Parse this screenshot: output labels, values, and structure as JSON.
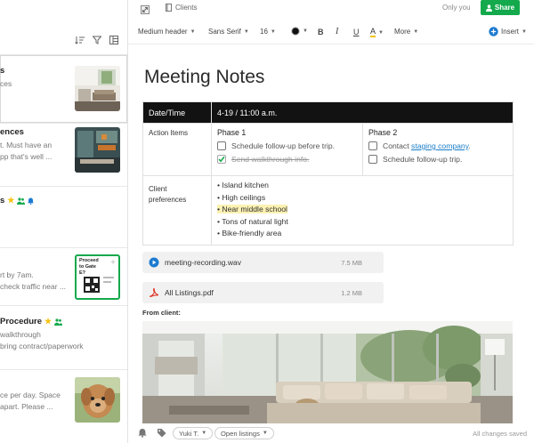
{
  "topbar": {
    "breadcrumb": "Clients",
    "sharing": "Only you",
    "share_label": "Share"
  },
  "toolbar": {
    "style": "Medium header",
    "font": "Sans Serif",
    "size": "16",
    "bold": "B",
    "italic": "I",
    "underline": "U",
    "highlight": "A",
    "more": "More",
    "insert": "Insert"
  },
  "note_list": [
    {
      "title": "s",
      "snippet": "ces",
      "thumb": "living-room"
    },
    {
      "title": "ences",
      "snippet": "t. Must have an\npp that's well ...",
      "thumb": "kitchen"
    },
    {
      "title": "s",
      "snippet": "",
      "thumb": ""
    },
    {
      "title": "",
      "snippet": "rt by 7am.\ncheck traffic near ...",
      "thumb": "boarding-pass",
      "thumb_text": "Proceed to Gate E?"
    },
    {
      "title": "Procedure",
      "snippet": "walkthrough\nbring contract/paperwork",
      "thumb": ""
    },
    {
      "title": "",
      "snippet": "ce per day. Space\napart. Please ...",
      "thumb": "dog"
    }
  ],
  "document": {
    "title": "Meeting Notes",
    "table": {
      "header_label": "Date/Time",
      "header_value": "4-19 / 11:00 a.m.",
      "action_label": "Action Items",
      "phase1": {
        "title": "Phase 1",
        "items": [
          {
            "text": "Schedule follow-up before trip.",
            "checked": false
          },
          {
            "text": "Send walkthrough info.",
            "checked": true
          }
        ]
      },
      "phase2": {
        "title": "Phase 2",
        "item1_prefix": "Contact",
        "item1_link": "staging company",
        "item1_suffix": ".",
        "item2": "Schedule follow-up trip."
      },
      "client_label": "Client preferences",
      "preferences": [
        "• Island kitchen",
        "• High ceilings",
        "• Near middle school",
        "• Tons of natural light",
        "• Bike-friendly area"
      ]
    },
    "attachments": [
      {
        "name": "meeting-recording.wav",
        "size": "7.5 MB",
        "icon": "audio-icon"
      },
      {
        "name": "All Listings.pdf",
        "size": "1.2 MB",
        "icon": "pdf-icon"
      }
    ],
    "from_client": "From client:"
  },
  "footer": {
    "user": "Yuki T.",
    "tag": "Open listings",
    "status": "All changes saved"
  },
  "colors": {
    "accent_green": "#14a94c",
    "link": "#1a7dc8",
    "highlight": "#fbf1b3"
  }
}
